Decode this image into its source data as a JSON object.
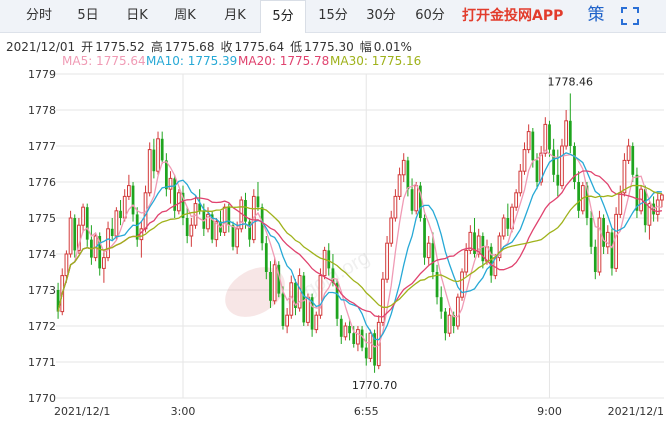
{
  "tabs": [
    {
      "label": "分时",
      "active": false
    },
    {
      "label": "5日",
      "active": false
    },
    {
      "label": "日K",
      "active": false
    },
    {
      "label": "周K",
      "active": false
    },
    {
      "label": "月K",
      "active": false
    },
    {
      "label": "5分",
      "active": true
    },
    {
      "label": "15分",
      "active": false
    },
    {
      "label": "30分",
      "active": false
    },
    {
      "label": "60分",
      "active": false
    }
  ],
  "app_link": "打开金投网APP",
  "icons": [
    "strategy-icon",
    "fullscreen-icon"
  ],
  "strategy_label": "策",
  "info": {
    "date": "2021/12/01",
    "open_label": "开",
    "open": "1775.52",
    "high_label": "高",
    "high": "1775.68",
    "close_label": "收",
    "close": "1775.64",
    "low_label": "低",
    "low": "1775.30",
    "change_label": "幅",
    "change": "0.01%"
  },
  "ma_legend": [
    {
      "label": "MA5: 1775.64",
      "color": "#f09bb5"
    },
    {
      "label": "MA10: 1775.39",
      "color": "#27a9d6"
    },
    {
      "label": "MA20: 1775.78",
      "color": "#e0436f"
    },
    {
      "label": "MA30: 1775.16",
      "color": "#9fb21b"
    }
  ],
  "watermark": "cngold.org",
  "colors": {
    "up": "#d23a3a",
    "down": "#1ea41e",
    "grid": "#e6e6e6"
  },
  "chart_data": {
    "type": "candlestick",
    "ylim": [
      1770,
      1779
    ],
    "yticks": [
      "1770",
      "1771",
      "1772",
      "1773",
      "1774",
      "1775",
      "1776",
      "1777",
      "1778",
      "1779"
    ],
    "xticks": [
      "2021/12/1",
      "3:00",
      "6:55",
      "9:00",
      "2021/12/1"
    ],
    "xtick_index": [
      0,
      30,
      74,
      118,
      146
    ],
    "annotations": [
      {
        "text": "1778.46",
        "at": 123,
        "value": 1778.46
      },
      {
        "text": "1770.70",
        "at": 76,
        "value": 1770.7
      }
    ],
    "ohlc": [
      [
        1773.0,
        1773.2,
        1772.2,
        1772.4
      ],
      [
        1772.4,
        1773.6,
        1772.3,
        1773.4
      ],
      [
        1773.4,
        1774.1,
        1773.2,
        1774.0
      ],
      [
        1774.0,
        1775.2,
        1773.9,
        1775.0
      ],
      [
        1775.0,
        1775.1,
        1773.9,
        1774.1
      ],
      [
        1774.1,
        1775.0,
        1774.0,
        1774.8
      ],
      [
        1774.8,
        1775.4,
        1774.6,
        1775.3
      ],
      [
        1775.3,
        1775.4,
        1774.2,
        1774.4
      ],
      [
        1774.4,
        1774.8,
        1773.7,
        1773.9
      ],
      [
        1773.9,
        1774.6,
        1773.8,
        1774.5
      ],
      [
        1774.5,
        1774.6,
        1773.4,
        1773.6
      ],
      [
        1773.6,
        1774.1,
        1773.2,
        1773.9
      ],
      [
        1773.9,
        1774.9,
        1773.8,
        1774.7
      ],
      [
        1774.7,
        1775.0,
        1774.4,
        1774.5
      ],
      [
        1774.5,
        1775.3,
        1774.4,
        1775.2
      ],
      [
        1775.2,
        1775.5,
        1774.8,
        1775.0
      ],
      [
        1775.0,
        1775.8,
        1774.9,
        1775.6
      ],
      [
        1775.6,
        1776.2,
        1775.5,
        1775.9
      ],
      [
        1775.9,
        1776.0,
        1774.9,
        1775.1
      ],
      [
        1775.1,
        1775.3,
        1774.2,
        1774.4
      ],
      [
        1774.4,
        1774.9,
        1773.9,
        1774.7
      ],
      [
        1774.7,
        1775.9,
        1774.6,
        1775.7
      ],
      [
        1775.7,
        1777.1,
        1775.6,
        1776.9
      ],
      [
        1776.9,
        1777.2,
        1776.1,
        1776.3
      ],
      [
        1776.3,
        1777.4,
        1776.2,
        1777.2
      ],
      [
        1777.2,
        1777.4,
        1776.5,
        1776.6
      ],
      [
        1776.6,
        1776.8,
        1775.6,
        1775.8
      ],
      [
        1775.8,
        1776.3,
        1775.4,
        1776.1
      ],
      [
        1776.1,
        1776.2,
        1775.0,
        1775.2
      ],
      [
        1775.2,
        1775.8,
        1775.1,
        1775.7
      ],
      [
        1775.7,
        1775.9,
        1774.8,
        1775.0
      ],
      [
        1775.0,
        1775.3,
        1774.3,
        1774.5
      ],
      [
        1774.5,
        1775.0,
        1774.2,
        1774.8
      ],
      [
        1774.8,
        1775.6,
        1774.7,
        1775.4
      ],
      [
        1775.4,
        1775.8,
        1775.1,
        1775.2
      ],
      [
        1775.2,
        1775.4,
        1774.5,
        1774.7
      ],
      [
        1774.7,
        1775.3,
        1774.6,
        1775.1
      ],
      [
        1775.1,
        1775.2,
        1774.3,
        1774.4
      ],
      [
        1774.4,
        1775.0,
        1774.2,
        1774.9
      ],
      [
        1774.9,
        1775.2,
        1774.5,
        1774.6
      ],
      [
        1774.6,
        1775.4,
        1774.5,
        1775.3
      ],
      [
        1775.3,
        1775.4,
        1774.6,
        1774.8
      ],
      [
        1774.8,
        1774.9,
        1774.1,
        1774.2
      ],
      [
        1774.2,
        1774.9,
        1774.0,
        1774.7
      ],
      [
        1774.7,
        1775.6,
        1774.6,
        1775.5
      ],
      [
        1775.5,
        1775.7,
        1774.7,
        1774.9
      ],
      [
        1774.9,
        1775.0,
        1774.2,
        1774.4
      ],
      [
        1774.4,
        1775.8,
        1774.3,
        1775.6
      ],
      [
        1775.6,
        1776.0,
        1775.2,
        1775.3
      ],
      [
        1775.3,
        1775.4,
        1774.1,
        1774.3
      ],
      [
        1774.3,
        1774.5,
        1773.3,
        1773.5
      ],
      [
        1773.5,
        1773.8,
        1772.5,
        1772.7
      ],
      [
        1772.7,
        1773.9,
        1772.6,
        1773.7
      ],
      [
        1773.7,
        1773.8,
        1772.8,
        1772.9
      ],
      [
        1772.9,
        1773.1,
        1771.9,
        1772.0
      ],
      [
        1772.0,
        1772.5,
        1771.8,
        1772.3
      ],
      [
        1772.3,
        1773.4,
        1772.2,
        1773.2
      ],
      [
        1773.2,
        1773.3,
        1772.3,
        1772.5
      ],
      [
        1772.5,
        1773.6,
        1772.4,
        1773.4
      ],
      [
        1773.4,
        1773.5,
        1772.0,
        1772.1
      ],
      [
        1772.1,
        1772.9,
        1772.0,
        1772.8
      ],
      [
        1772.8,
        1772.9,
        1771.7,
        1771.9
      ],
      [
        1771.9,
        1772.4,
        1771.8,
        1772.3
      ],
      [
        1772.3,
        1773.6,
        1772.2,
        1773.4
      ],
      [
        1773.4,
        1774.2,
        1773.3,
        1774.1
      ],
      [
        1774.1,
        1774.3,
        1773.4,
        1773.6
      ],
      [
        1773.6,
        1774.0,
        1773.1,
        1773.2
      ],
      [
        1773.2,
        1773.3,
        1772.0,
        1772.2
      ],
      [
        1772.2,
        1772.3,
        1771.5,
        1771.7
      ],
      [
        1771.7,
        1772.1,
        1771.6,
        1772.0
      ],
      [
        1772.0,
        1772.2,
        1771.6,
        1771.8
      ],
      [
        1771.8,
        1772.0,
        1771.4,
        1771.5
      ],
      [
        1771.5,
        1772.0,
        1771.3,
        1771.9
      ],
      [
        1771.9,
        1772.0,
        1771.3,
        1771.4
      ],
      [
        1771.4,
        1771.8,
        1770.9,
        1771.1
      ],
      [
        1771.1,
        1771.9,
        1771.0,
        1771.8
      ],
      [
        1771.8,
        1771.9,
        1770.7,
        1770.9
      ],
      [
        1770.9,
        1772.3,
        1770.8,
        1772.1
      ],
      [
        1772.1,
        1773.5,
        1772.0,
        1773.3
      ],
      [
        1773.3,
        1774.5,
        1773.2,
        1774.3
      ],
      [
        1774.3,
        1775.2,
        1774.2,
        1775.0
      ],
      [
        1775.0,
        1775.8,
        1774.9,
        1775.6
      ],
      [
        1775.6,
        1776.4,
        1775.5,
        1776.2
      ],
      [
        1776.2,
        1776.8,
        1776.0,
        1776.6
      ],
      [
        1776.6,
        1776.7,
        1775.6,
        1775.8
      ],
      [
        1775.8,
        1776.1,
        1775.1,
        1775.2
      ],
      [
        1775.2,
        1776.0,
        1775.1,
        1775.9
      ],
      [
        1775.9,
        1776.0,
        1774.9,
        1775.0
      ],
      [
        1775.0,
        1775.1,
        1773.7,
        1773.9
      ],
      [
        1773.9,
        1774.5,
        1773.7,
        1774.3
      ],
      [
        1774.3,
        1774.6,
        1773.3,
        1773.5
      ],
      [
        1773.5,
        1773.7,
        1772.6,
        1772.8
      ],
      [
        1772.8,
        1773.1,
        1772.2,
        1772.4
      ],
      [
        1772.4,
        1772.5,
        1771.6,
        1771.8
      ],
      [
        1771.8,
        1772.5,
        1771.7,
        1772.3
      ],
      [
        1772.3,
        1772.4,
        1771.8,
        1772.0
      ],
      [
        1772.0,
        1772.9,
        1771.9,
        1772.8
      ],
      [
        1772.8,
        1773.6,
        1772.7,
        1773.5
      ],
      [
        1773.5,
        1774.3,
        1773.4,
        1774.1
      ],
      [
        1774.1,
        1774.8,
        1774.0,
        1774.6
      ],
      [
        1774.6,
        1775.0,
        1773.9,
        1774.0
      ],
      [
        1774.0,
        1774.7,
        1773.9,
        1774.5
      ],
      [
        1774.5,
        1774.6,
        1773.6,
        1773.8
      ],
      [
        1773.8,
        1774.4,
        1773.7,
        1774.2
      ],
      [
        1774.2,
        1774.3,
        1773.2,
        1773.4
      ],
      [
        1773.4,
        1774.0,
        1773.3,
        1773.9
      ],
      [
        1773.9,
        1774.6,
        1773.8,
        1774.5
      ],
      [
        1774.5,
        1775.1,
        1774.4,
        1775.0
      ],
      [
        1775.0,
        1775.4,
        1774.5,
        1774.7
      ],
      [
        1774.7,
        1775.4,
        1774.6,
        1775.3
      ],
      [
        1775.3,
        1775.8,
        1775.2,
        1775.7
      ],
      [
        1775.7,
        1776.5,
        1775.6,
        1776.3
      ],
      [
        1776.3,
        1777.1,
        1776.2,
        1776.9
      ],
      [
        1776.9,
        1777.6,
        1776.8,
        1777.4
      ],
      [
        1777.4,
        1777.5,
        1776.4,
        1776.6
      ],
      [
        1776.6,
        1776.8,
        1775.8,
        1776.0
      ],
      [
        1776.0,
        1777.0,
        1775.9,
        1776.8
      ],
      [
        1776.8,
        1777.8,
        1776.7,
        1777.6
      ],
      [
        1777.6,
        1777.7,
        1776.7,
        1776.9
      ],
      [
        1776.9,
        1777.2,
        1776.0,
        1776.2
      ],
      [
        1776.2,
        1776.9,
        1775.6,
        1775.9
      ],
      [
        1775.9,
        1777.2,
        1775.8,
        1777.0
      ],
      [
        1777.0,
        1778.0,
        1776.9,
        1777.7
      ],
      [
        1777.7,
        1778.46,
        1776.8,
        1777.0
      ],
      [
        1777.0,
        1777.1,
        1775.8,
        1776.0
      ],
      [
        1776.0,
        1776.3,
        1775.0,
        1775.2
      ],
      [
        1775.2,
        1776.0,
        1775.1,
        1775.9
      ],
      [
        1775.9,
        1776.0,
        1774.8,
        1775.0
      ],
      [
        1775.0,
        1775.2,
        1774.0,
        1774.2
      ],
      [
        1774.2,
        1774.4,
        1773.3,
        1773.5
      ],
      [
        1773.5,
        1775.2,
        1773.4,
        1775.0
      ],
      [
        1775.0,
        1775.1,
        1774.0,
        1774.2
      ],
      [
        1774.2,
        1774.8,
        1774.0,
        1774.6
      ],
      [
        1774.6,
        1774.7,
        1773.4,
        1773.6
      ],
      [
        1773.6,
        1775.3,
        1773.5,
        1775.1
      ],
      [
        1775.1,
        1775.9,
        1775.0,
        1775.7
      ],
      [
        1775.7,
        1776.8,
        1775.6,
        1776.6
      ],
      [
        1776.6,
        1777.2,
        1776.5,
        1777.0
      ],
      [
        1777.0,
        1777.1,
        1776.0,
        1776.2
      ],
      [
        1776.2,
        1776.4,
        1775.0,
        1775.2
      ],
      [
        1775.2,
        1775.9,
        1775.1,
        1775.8
      ],
      [
        1775.8,
        1775.9,
        1774.6,
        1774.8
      ],
      [
        1774.8,
        1775.5,
        1774.4,
        1775.4
      ],
      [
        1775.4,
        1775.6,
        1774.9,
        1775.1
      ],
      [
        1775.1,
        1775.7,
        1774.9,
        1775.5
      ],
      [
        1775.5,
        1775.68,
        1775.3,
        1775.64
      ]
    ]
  }
}
